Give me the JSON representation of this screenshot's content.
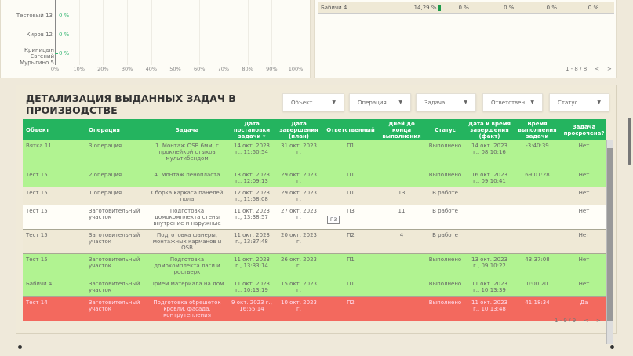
{
  "chart": {
    "type": "bar",
    "orientation": "horizontal",
    "categories": [
      "Тестовый 13",
      "Киров 12",
      "Криницын Евгений Мурыгино 5"
    ],
    "values": [
      0,
      0,
      0
    ],
    "value_labels": [
      "0 %",
      "0 %",
      "0 %"
    ],
    "xticks": [
      "0%",
      "10%",
      "20%",
      "30%",
      "40%",
      "50%",
      "60%",
      "70%",
      "80%",
      "90%",
      "100%"
    ],
    "xlim": [
      0,
      100
    ],
    "color": "#3cb878"
  },
  "top_table": {
    "row": [
      "Бабичи 4",
      "14,29 %",
      "0 %",
      "0 %",
      "0 %",
      "0 %"
    ],
    "bar_fraction": 0.1429,
    "pagination": "1 - 8 / 8"
  },
  "main": {
    "title": "ДЕТАЛИЗАЦИЯ ВЫДАННЫХ ЗАДАЧ В ПРОИЗВОДСТВЕ",
    "filters": [
      "Объект",
      "Операция",
      "Задача",
      "Ответствен...",
      "Статус"
    ],
    "columns": [
      "Объект",
      "Операция",
      "Задача",
      "Дата постановки задачи ▾",
      "Дата завершения (план)",
      "Ответственный",
      "Дней до конца выполнения",
      "Статус",
      "Дата и время завершения (факт)",
      "Время выполнения задачи",
      "Задача просрочена?"
    ],
    "rows": [
      {
        "color": "green",
        "cells": [
          "Вятка 11",
          "3 операция",
          "1. Монтаж OSB 6мм, с проклейкой стыков мультибендом",
          "14 окт. 2023 г., 11:50:54",
          "31 окт. 2023 г.",
          "П1",
          "",
          "Выполнено",
          "14 окт. 2023 г., 08:10:16",
          "-3:40:39",
          "Нет"
        ]
      },
      {
        "color": "green",
        "cells": [
          "Тест 15",
          "2 операция",
          "4. Монтаж пенопласта",
          "13 окт. 2023 г., 12:09:13",
          "29 окт. 2023 г.",
          "П1",
          "",
          "Выполнено",
          "16 окт. 2023 г., 09:10:41",
          "69:01:28",
          "Нет"
        ]
      },
      {
        "color": "beige",
        "cells": [
          "Тест 15",
          "1 операция",
          "Сборка каркаса панелей пола",
          "12 окт. 2023 г., 11:58:08",
          "29 окт. 2023 г.",
          "П1",
          "13",
          "В работе",
          "",
          "",
          "Нет"
        ]
      },
      {
        "color": "white",
        "cells": [
          "Тест 15",
          "Заготовительный участок",
          "Подготовка домокомплекта стены внутрение и наружные",
          "11 окт. 2023 г., 13:38:57",
          "27 окт. 2023 г.",
          "П3",
          "11",
          "В работе",
          "",
          "",
          "Нет"
        ]
      },
      {
        "color": "beige",
        "cells": [
          "Тест 15",
          "Заготовительный участок",
          "Подготовка фанеры, монтажных карманов и OSB",
          "11 окт. 2023 г., 13:37:48",
          "20 окт. 2023 г.",
          "П2",
          "4",
          "В работе",
          "",
          "",
          "Нет"
        ]
      },
      {
        "color": "green",
        "cells": [
          "Тест 15",
          "Заготовительный участок",
          "Подготовка домокомплекта лаги и ростверк",
          "11 окт. 2023 г., 13:33:14",
          "26 окт. 2023 г.",
          "П1",
          "",
          "Выполнено",
          "13 окт. 2023 г., 09:10:22",
          "43:37:08",
          "Нет"
        ]
      },
      {
        "color": "green",
        "cells": [
          "Бабичи 4",
          "Заготовительный участок",
          "Прием материала на дом",
          "11 окт. 2023 г., 10:13:19",
          "15 окт. 2023 г.",
          "П1",
          "",
          "Выполнено",
          "11 окт. 2023 г., 10:13:39",
          "0:00:20",
          "Нет"
        ]
      },
      {
        "color": "red",
        "cells": [
          "Тест 14",
          "Заготовительный участок",
          "Подготовка обрешеток кровли, фасада, контрутепления",
          "9 окт. 2023 г., 16:55:14",
          "10 окт. 2023 г.",
          "П2",
          "",
          "Выполнено",
          "11 окт. 2023 г., 10:13:48",
          "41:18:34",
          "Да"
        ]
      }
    ],
    "tooltip": "П3",
    "pagination": "1 - 9 / 9"
  }
}
